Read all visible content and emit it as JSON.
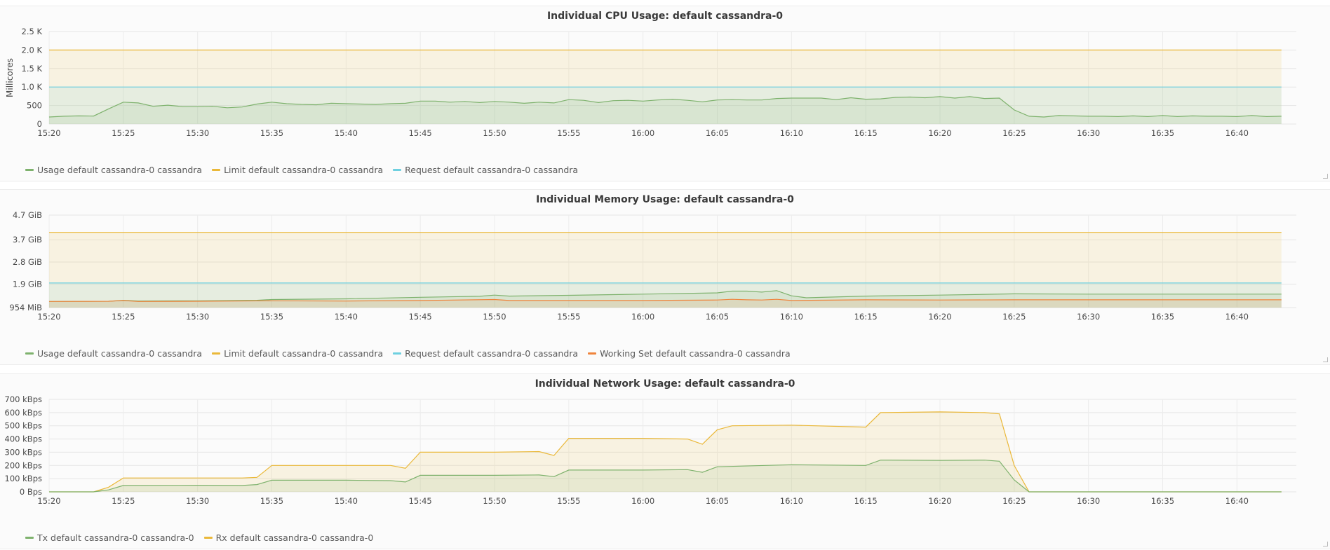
{
  "chart_data": [
    {
      "id": "cpu",
      "type": "area",
      "title": "Individual CPU Usage: default cassandra-0",
      "ylabel": "Millicores",
      "ylim": [
        0,
        2500
      ],
      "yticks": [
        0,
        500,
        1000,
        1500,
        2000,
        2500
      ],
      "ytick_labels": [
        "0",
        "500",
        "1.0 K",
        "1.5 K",
        "2.0 K",
        "2.5 K"
      ],
      "xlim": [
        "15:20",
        "16:44"
      ],
      "xtick_labels": [
        "15:20",
        "15:25",
        "15:30",
        "15:35",
        "15:40",
        "15:45",
        "15:50",
        "15:55",
        "16:00",
        "16:05",
        "16:10",
        "16:15",
        "16:20",
        "16:25",
        "16:30",
        "16:35",
        "16:40"
      ],
      "grid": true,
      "legend_position": "bottom-left",
      "series": [
        {
          "name": "Usage default cassandra-0 cassandra",
          "color": "#7eb26d",
          "x": [
            "15:20",
            "15:21",
            "15:22",
            "15:23",
            "15:24",
            "15:25",
            "15:26",
            "15:27",
            "15:28",
            "15:29",
            "15:30",
            "15:31",
            "15:32",
            "15:33",
            "15:34",
            "15:35",
            "15:36",
            "15:37",
            "15:38",
            "15:39",
            "15:40",
            "15:41",
            "15:42",
            "15:43",
            "15:44",
            "15:45",
            "15:46",
            "15:47",
            "15:48",
            "15:49",
            "15:50",
            "15:51",
            "15:52",
            "15:53",
            "15:54",
            "15:55",
            "15:56",
            "15:57",
            "15:58",
            "15:59",
            "16:00",
            "16:01",
            "16:02",
            "16:03",
            "16:04",
            "16:05",
            "16:06",
            "16:07",
            "16:08",
            "16:09",
            "16:10",
            "16:11",
            "16:12",
            "16:13",
            "16:14",
            "16:15",
            "16:16",
            "16:17",
            "16:18",
            "16:19",
            "16:20",
            "16:21",
            "16:22",
            "16:23",
            "16:24",
            "16:25",
            "16:26",
            "16:27",
            "16:28",
            "16:29",
            "16:30",
            "16:31",
            "16:32",
            "16:33",
            "16:34",
            "16:35",
            "16:36",
            "16:37",
            "16:38",
            "16:39",
            "16:40",
            "16:41",
            "16:42",
            "16:43"
          ],
          "values": [
            190,
            210,
            220,
            215,
            410,
            590,
            570,
            480,
            510,
            470,
            470,
            480,
            440,
            460,
            540,
            590,
            550,
            530,
            520,
            560,
            550,
            540,
            530,
            550,
            560,
            620,
            620,
            590,
            610,
            580,
            610,
            590,
            560,
            590,
            570,
            660,
            640,
            580,
            630,
            640,
            620,
            650,
            670,
            640,
            600,
            650,
            660,
            650,
            650,
            690,
            700,
            700,
            700,
            660,
            710,
            670,
            680,
            720,
            730,
            710,
            740,
            700,
            740,
            690,
            700,
            380,
            210,
            190,
            230,
            220,
            210,
            210,
            200,
            220,
            200,
            230,
            200,
            220,
            210,
            210,
            200,
            230,
            200,
            210
          ]
        },
        {
          "name": "Limit default cassandra-0 cassandra",
          "color": "#eab839",
          "x": [
            "15:20",
            "16:43"
          ],
          "values": [
            2000,
            2000
          ]
        },
        {
          "name": "Request default cassandra-0 cassandra",
          "color": "#6ed0e0",
          "x": [
            "15:20",
            "16:43"
          ],
          "values": [
            1000,
            1000
          ]
        }
      ]
    },
    {
      "id": "mem",
      "type": "area",
      "title": "Individual Memory Usage: default cassandra-0",
      "ylabel": "",
      "ylim": [
        0.954,
        4.7
      ],
      "yticks": [
        0.954,
        1.9,
        2.8,
        3.7,
        4.7
      ],
      "ytick_labels": [
        "954 MiB",
        "1.9 GiB",
        "2.8 GiB",
        "3.7 GiB",
        "4.7 GiB"
      ],
      "xlim": [
        "15:20",
        "16:44"
      ],
      "xtick_labels": [
        "15:20",
        "15:25",
        "15:30",
        "15:35",
        "15:40",
        "15:45",
        "15:50",
        "15:55",
        "16:00",
        "16:05",
        "16:10",
        "16:15",
        "16:20",
        "16:25",
        "16:30",
        "16:35",
        "16:40"
      ],
      "grid": true,
      "legend_position": "bottom-left",
      "series": [
        {
          "name": "Usage default cassandra-0 cassandra",
          "color": "#7eb26d",
          "x": [
            "15:20",
            "15:24",
            "15:25",
            "15:26",
            "15:30",
            "15:34",
            "15:35",
            "15:40",
            "15:45",
            "15:49",
            "15:50",
            "15:51",
            "15:55",
            "16:00",
            "16:05",
            "16:06",
            "16:07",
            "16:08",
            "16:09",
            "16:10",
            "16:11",
            "16:15",
            "16:20",
            "16:25",
            "16:30",
            "16:43"
          ],
          "values": [
            1.2,
            1.21,
            1.25,
            1.22,
            1.23,
            1.25,
            1.28,
            1.31,
            1.37,
            1.41,
            1.46,
            1.42,
            1.45,
            1.5,
            1.55,
            1.62,
            1.62,
            1.58,
            1.64,
            1.43,
            1.35,
            1.42,
            1.46,
            1.51,
            1.5,
            1.5
          ]
        },
        {
          "name": "Limit default cassandra-0 cassandra",
          "color": "#eab839",
          "x": [
            "15:20",
            "16:43"
          ],
          "values": [
            4.0,
            4.0
          ]
        },
        {
          "name": "Request default cassandra-0 cassandra",
          "color": "#6ed0e0",
          "x": [
            "15:20",
            "16:43"
          ],
          "values": [
            1.95,
            1.95
          ]
        },
        {
          "name": "Working Set default cassandra-0 cassandra",
          "color": "#ef843c",
          "x": [
            "15:20",
            "15:24",
            "15:25",
            "15:26",
            "15:30",
            "15:35",
            "15:40",
            "15:45",
            "15:50",
            "15:51",
            "15:55",
            "16:00",
            "16:05",
            "16:06",
            "16:07",
            "16:08",
            "16:09",
            "16:10",
            "16:15",
            "16:20",
            "16:25",
            "16:43"
          ],
          "values": [
            1.2,
            1.21,
            1.24,
            1.2,
            1.21,
            1.23,
            1.22,
            1.24,
            1.28,
            1.24,
            1.24,
            1.24,
            1.26,
            1.29,
            1.27,
            1.26,
            1.29,
            1.24,
            1.27,
            1.26,
            1.27,
            1.27
          ]
        }
      ]
    },
    {
      "id": "net",
      "type": "area",
      "title": "Individual Network Usage: default cassandra-0",
      "ylabel": "",
      "ylim": [
        0,
        700
      ],
      "yticks": [
        0,
        100,
        200,
        300,
        400,
        500,
        600,
        700
      ],
      "ytick_labels": [
        "0 Bps",
        "100 kBps",
        "200 kBps",
        "300 kBps",
        "400 kBps",
        "500 kBps",
        "600 kBps",
        "700 kBps"
      ],
      "xlim": [
        "15:20",
        "16:44"
      ],
      "xtick_labels": [
        "15:20",
        "15:25",
        "15:30",
        "15:35",
        "15:40",
        "15:45",
        "15:50",
        "15:55",
        "16:00",
        "16:05",
        "16:10",
        "16:15",
        "16:20",
        "16:25",
        "16:30",
        "16:35",
        "16:40"
      ],
      "grid": true,
      "legend_position": "bottom-left",
      "series": [
        {
          "name": "Tx default cassandra-0 cassandra-0",
          "color": "#7eb26d",
          "x": [
            "15:20",
            "15:23",
            "15:24",
            "15:25",
            "15:30",
            "15:33",
            "15:34",
            "15:35",
            "15:40",
            "15:43",
            "15:44",
            "15:45",
            "15:50",
            "15:53",
            "15:54",
            "15:55",
            "16:00",
            "16:03",
            "16:04",
            "16:05",
            "16:10",
            "16:15",
            "16:16",
            "16:20",
            "16:23",
            "16:24",
            "16:25",
            "16:26",
            "16:43"
          ],
          "values": [
            0,
            0,
            15,
            48,
            50,
            48,
            55,
            88,
            88,
            85,
            75,
            125,
            125,
            128,
            115,
            165,
            165,
            168,
            148,
            190,
            205,
            200,
            240,
            238,
            240,
            232,
            90,
            0,
            0
          ]
        },
        {
          "name": "Rx default cassandra-0 cassandra-0",
          "color": "#eab839",
          "x": [
            "15:20",
            "15:23",
            "15:24",
            "15:25",
            "15:30",
            "15:33",
            "15:34",
            "15:35",
            "15:40",
            "15:43",
            "15:44",
            "15:45",
            "15:50",
            "15:53",
            "15:54",
            "15:55",
            "16:00",
            "16:03",
            "16:04",
            "16:05",
            "16:06",
            "16:10",
            "16:15",
            "16:16",
            "16:20",
            "16:23",
            "16:24",
            "16:25",
            "16:26",
            "16:43"
          ],
          "values": [
            0,
            0,
            35,
            105,
            105,
            105,
            110,
            200,
            200,
            200,
            178,
            300,
            300,
            305,
            275,
            405,
            405,
            400,
            360,
            470,
            500,
            505,
            490,
            600,
            605,
            600,
            590,
            200,
            0,
            0
          ]
        }
      ]
    }
  ]
}
